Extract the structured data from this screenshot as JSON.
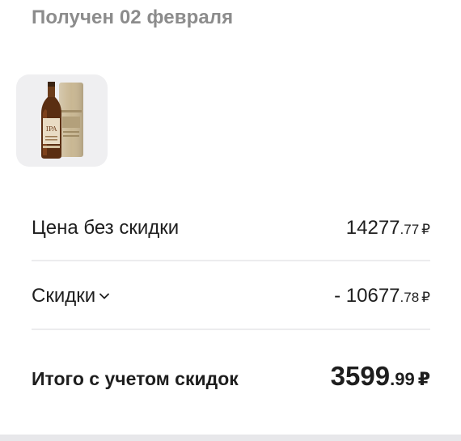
{
  "order": {
    "status_title": "Получен 02 февраля"
  },
  "product": {
    "image_icon": "whisky-bottle-with-tube"
  },
  "summary": {
    "price_label": "Цена без скидки",
    "price_int": "14277",
    "price_dec": ".77",
    "discount_label": "Скидки",
    "discount_int": "- 10677",
    "discount_dec": ".78",
    "total_label": "Итого с учетом скидок",
    "total_int": "3599",
    "total_dec": ".99",
    "currency": "₽"
  },
  "colors": {
    "header_gray": "#8c8c8c",
    "text": "#1e1e1e",
    "thumb_bg": "#efeff1",
    "divider": "#ececee"
  }
}
